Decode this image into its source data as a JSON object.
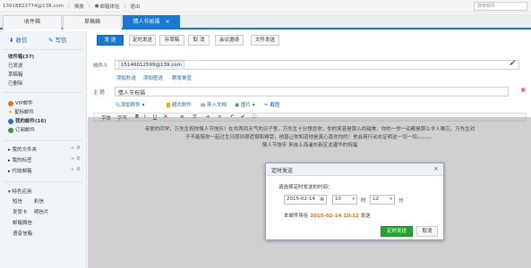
{
  "topbar": {
    "account": "13918822774@139.com",
    "switch": "换肤",
    "security": "邮箱体验",
    "logout": "退出",
    "search_placeholder": "搜索邮件"
  },
  "tabs": [
    {
      "label": "收件箱"
    },
    {
      "label": "草稿箱"
    },
    {
      "label": "情人节祝福"
    }
  ],
  "sidebar": {
    "receive": "收信",
    "compose": "写信",
    "folders": [
      "收件箱(37)",
      "已发送",
      "草稿箱",
      "已删除"
    ],
    "special": [
      "VIP邮件",
      "星标邮件",
      "我的邮件(16)",
      "订阅邮件"
    ],
    "groups": [
      "我的文件夹",
      "我的标签",
      "代收邮箱"
    ],
    "apps_title": "特色应用",
    "apps": [
      "短信",
      "彩信",
      "发贺卡",
      "明信片",
      "邮箱微信",
      "语音信箱"
    ]
  },
  "toolbar": {
    "send": "发 送",
    "timed_send": "定时发送",
    "save_draft": "存草稿",
    "cancel": "取 消",
    "meeting": "会议邀请",
    "file_send": "文件发送"
  },
  "compose": {
    "to_label": "收件人",
    "recipient": "15146012599@139.com",
    "add_cc": "添加抄送",
    "add_bcc": "添加密送",
    "group_send": "群发单显",
    "subject_label": "主 题",
    "subject": "情人节祝福",
    "attach": "添加附件",
    "big_attach": "超大附件",
    "import": "导入文档",
    "picture": "图片",
    "screenshot": "截图",
    "format": [
      "字体",
      "字号",
      "B",
      "I",
      "U",
      "A"
    ],
    "body_lines": [
      "亲爱的同学，万先生祝你情人节快乐！在共两同天气的日子里，万先生十分想念你，你的笑容是那么的甜美，你的一举一动都是那么令人难忘。万先生对",
      "于不能陪你一起过生日感到很遗憾和难受，他曾让你知道他是真心喜欢你的！他会用行动去证明这一切一切。。。。。。",
      "情人节快乐  来自上海浦东新区沈灌华的祝福"
    ]
  },
  "modal": {
    "title": "定时发送",
    "close": "×",
    "prompt": "请选择定时发送的时间：",
    "date": "2015-02-14",
    "hour": "10",
    "hour_unit": "时",
    "minute": "12",
    "minute_unit": "分",
    "note_prefix": "本邮件将在",
    "note_time": "2015-02-14 10:12",
    "note_suffix": "发送",
    "confirm": "定时发送",
    "cancel": "取消"
  },
  "colors": {
    "accent": "#1b78d0",
    "confirm_green": "#22a532",
    "highlight_orange": "#e8731a"
  }
}
